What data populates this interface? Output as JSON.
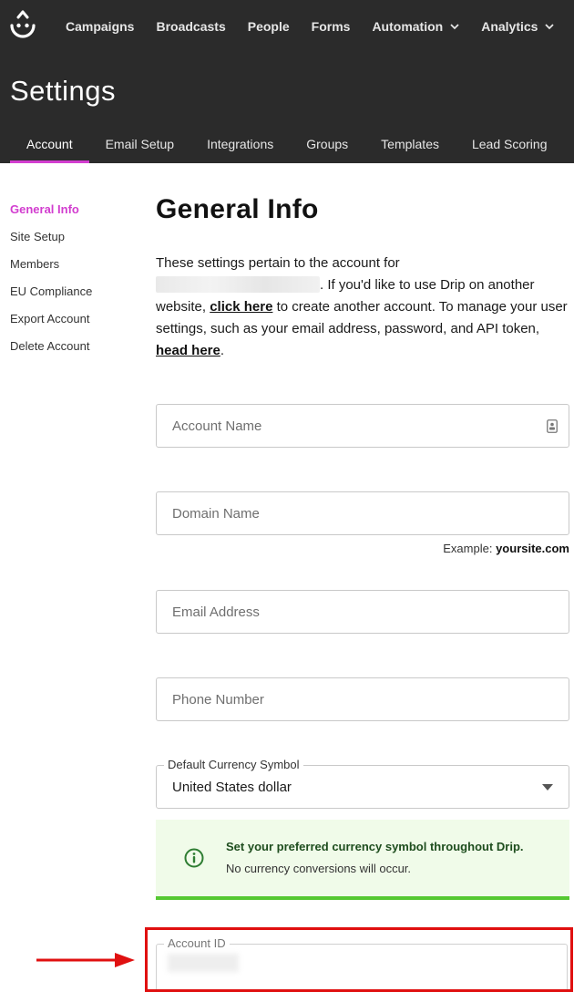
{
  "topnav": {
    "items": [
      {
        "label": "Campaigns",
        "dropdown": false
      },
      {
        "label": "Broadcasts",
        "dropdown": false
      },
      {
        "label": "People",
        "dropdown": false
      },
      {
        "label": "Forms",
        "dropdown": false
      },
      {
        "label": "Automation",
        "dropdown": true
      },
      {
        "label": "Analytics",
        "dropdown": true
      }
    ]
  },
  "page": {
    "title": "Settings"
  },
  "tabs": [
    {
      "label": "Account",
      "active": true
    },
    {
      "label": "Email Setup"
    },
    {
      "label": "Integrations"
    },
    {
      "label": "Groups"
    },
    {
      "label": "Templates"
    },
    {
      "label": "Lead Scoring"
    }
  ],
  "sidemenu": {
    "items": [
      {
        "label": "General Info",
        "active": true
      },
      {
        "label": "Site Setup"
      },
      {
        "label": "Members"
      },
      {
        "label": "EU Compliance"
      },
      {
        "label": "Export Account"
      },
      {
        "label": "Delete Account"
      }
    ]
  },
  "main": {
    "heading": "General Info",
    "intro": {
      "part1": "These settings pertain to the account for",
      "part2": ". If you'd like to use Drip on another website, ",
      "link1": "click here",
      "part3": " to create another account. To manage your user settings, such as your email address, password, and API token, ",
      "link2": "head here",
      "part4": "."
    },
    "fields": {
      "account_name": {
        "placeholder": "Account Name"
      },
      "domain_name": {
        "placeholder": "Domain Name"
      },
      "email_address": {
        "placeholder": "Email Address"
      },
      "phone_number": {
        "placeholder": "Phone Number"
      }
    },
    "example": {
      "prefix": "Example: ",
      "value": "yoursite.com"
    },
    "currency": {
      "legend": "Default Currency Symbol",
      "value": "United States dollar"
    },
    "notice": {
      "title": "Set your preferred currency symbol throughout Drip.",
      "body": "No currency conversions will occur."
    },
    "account_id": {
      "legend": "Account ID"
    }
  },
  "colors": {
    "header_bg": "#2b2b2b",
    "accent": "#d23dcf",
    "notice_bg": "#f0fbe9",
    "notice_border": "#55c832",
    "highlight": "#e01010"
  }
}
